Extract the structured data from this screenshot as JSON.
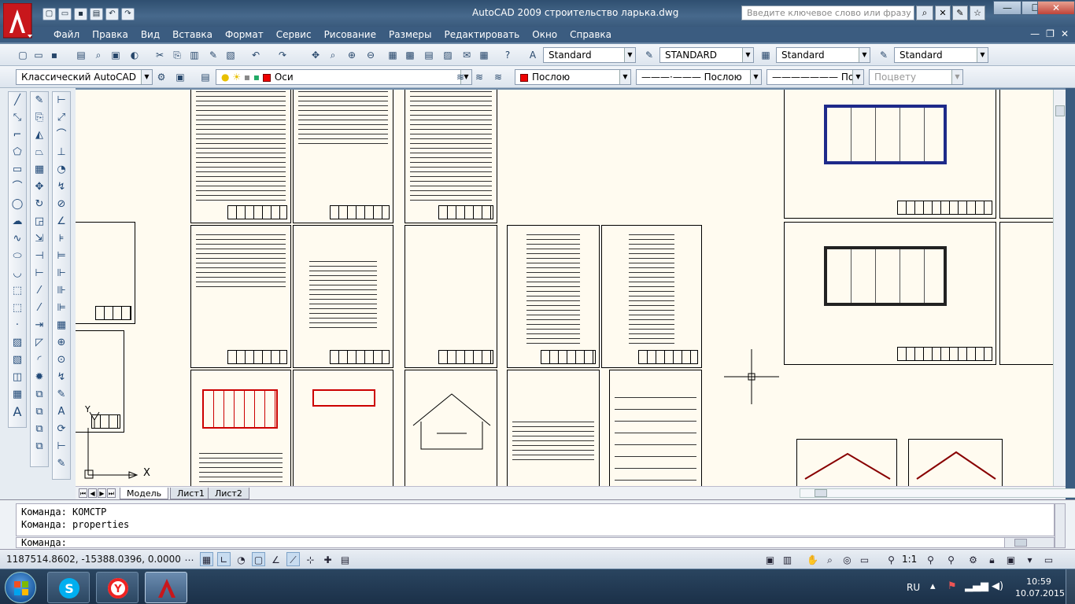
{
  "window": {
    "app_name": "AutoCAD 2009",
    "file_name": "строительство ларька.dwg",
    "search_placeholder": "Введите ключевое слово или фразу",
    "min": "—",
    "max": "☐",
    "close": "✕"
  },
  "menu": [
    "Файл",
    "Правка",
    "Вид",
    "Вставка",
    "Формат",
    "Сервис",
    "Рисование",
    "Размеры",
    "Редактировать",
    "Окно",
    "Справка"
  ],
  "mdi": {
    "min": "—",
    "restore": "❐",
    "close": "✕"
  },
  "toolbar1": {
    "text_style": "Standard",
    "dim_style": "STANDARD",
    "table_style": "Standard",
    "mleader_style": "Standard"
  },
  "toolbar2": {
    "workspace": "Классический AutoCAD",
    "layer": "Оси",
    "color": "Послою",
    "linetype": "Послою",
    "lineweight": "Послою",
    "plotstyle": "Поцвету"
  },
  "layout_tabs": [
    "Модель",
    "Лист1",
    "Лист2"
  ],
  "command": {
    "history": [
      "Команда:  КОМСТР",
      "Команда:  properties"
    ],
    "prompt": "Команда:"
  },
  "status": {
    "coords": "1187514.8602, -15388.0396, 0.0000",
    "scale": "1:1"
  },
  "ucs": {
    "x_label": "X",
    "y_label": "Y"
  },
  "taskbar": {
    "lang": "RU",
    "time": "10:59",
    "date": "10.07.2015"
  },
  "colors": {
    "titlebar": "#3b5c80",
    "canvas": "#fffbf0",
    "layer_color": "#ff0000"
  }
}
